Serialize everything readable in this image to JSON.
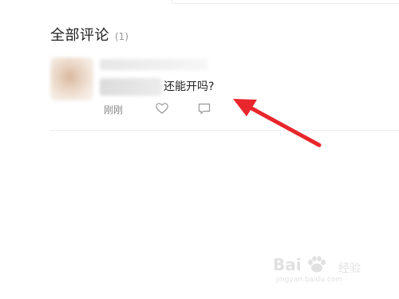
{
  "section": {
    "title": "全部评论",
    "count": "(1)"
  },
  "comment": {
    "text": "还能开吗?",
    "time": "刚刚",
    "like_icon": "heart-outline-icon",
    "reply_icon": "comment-bubble-icon"
  },
  "annotation": {
    "arrow_color": "#e8262b"
  },
  "watermark": {
    "brand": "Bai",
    "sub": "经验",
    "url": "jingyan.baidu.com"
  }
}
